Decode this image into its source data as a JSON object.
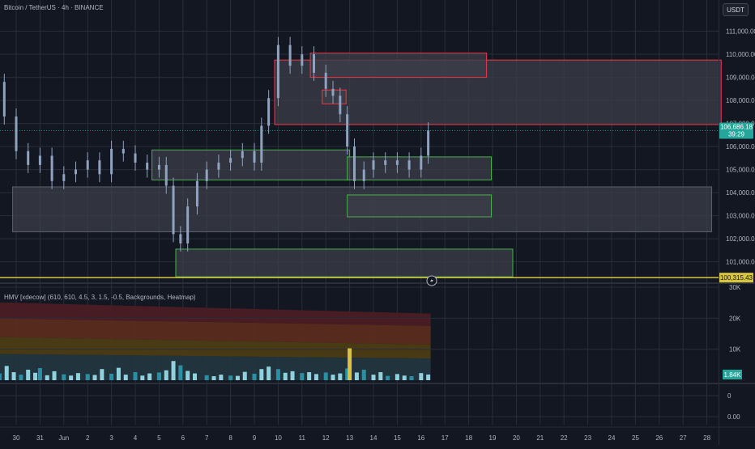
{
  "header": {
    "symbol_title": "Bitcoin / TetherUS · 4h · BINANCE",
    "currency_button": "USDT"
  },
  "indicator": {
    "label": "HMV [xdecow] (610, 610, 4.5, 3, 1.5, -0.5, Backgrounds, Heatmap)"
  },
  "colors": {
    "background": "#131722",
    "grid": "#2a2e39",
    "candle": "#8fa3c1",
    "red_zone_border": "#f23645",
    "green_zone_border": "#4caf50",
    "zone_fill": "#3c3f4a",
    "support_line": "#d7c440",
    "price_label_bg": "#26a69a",
    "volume_bar": "#8fd1dc",
    "volume_bar_dark": "#2b8fa3",
    "volume_spike": "#d7c440",
    "heat_red": "#4a1c24",
    "heat_orange": "#5a2c1e",
    "heat_olive": "#4a3c14",
    "heat_teal": "#223640"
  },
  "chart_data": [
    {
      "type": "candlestick",
      "title": "Bitcoin / TetherUS · 4h · BINANCE",
      "x_ticks": [
        "30",
        "31",
        "Jun",
        "2",
        "3",
        "4",
        "5",
        "6",
        "7",
        "8",
        "9",
        "10",
        "11",
        "12",
        "13",
        "14",
        "15",
        "16",
        "17",
        "18",
        "19",
        "20",
        "21",
        "22",
        "23",
        "24",
        "25",
        "26",
        "27",
        "28"
      ],
      "x_range": [
        29.0,
        28.2
      ],
      "y_ticks": [
        "111,000.00",
        "110,000.00",
        "109,000.00",
        "108,000.00",
        "107,000.00",
        "106,000.00",
        "105,000.00",
        "104,000.00",
        "103,000.00",
        "102,000.00",
        "101,000.00"
      ],
      "ylim": [
        100250,
        111300
      ],
      "grid": true,
      "last_price": {
        "value": 106686.18,
        "label": "106,686.18",
        "countdown": "39:29"
      },
      "support_line": {
        "value": 100315.43,
        "label": "100,315.43"
      },
      "zones": [
        {
          "kind": "bearish",
          "x0": 28.6,
          "x1": 9.85,
          "y_top": 109750,
          "y_bottom": 106950
        },
        {
          "kind": "bearish",
          "x0": 11.35,
          "x1": 18.75,
          "y_top": 110050,
          "y_bottom": 109000
        },
        {
          "kind": "bearish",
          "x0": 11.85,
          "x1": 12.85,
          "y_top": 108450,
          "y_bottom": 107850
        },
        {
          "kind": "neutral",
          "x0": 28.2,
          "x1": 29.85,
          "y_top": 104250,
          "y_bottom": 102300
        },
        {
          "kind": "bullish",
          "x0": 4.7,
          "x1": 13.0,
          "y_top": 105850,
          "y_bottom": 104550
        },
        {
          "kind": "bullish",
          "x0": 12.9,
          "x1": 18.95,
          "y_top": 105550,
          "y_bottom": 104550
        },
        {
          "kind": "bullish",
          "x0": 12.9,
          "x1": 18.95,
          "y_top": 103900,
          "y_bottom": 102950
        },
        {
          "kind": "bullish",
          "x0": 5.7,
          "x1": 19.85,
          "y_top": 101550,
          "y_bottom": 100350
        }
      ],
      "candles": [
        {
          "x": 29.0,
          "close": 108800
        },
        {
          "x": 29.5,
          "close": 107300
        },
        {
          "x": 30.0,
          "close": 105800
        },
        {
          "x": 30.5,
          "close": 105200
        },
        {
          "x": 31.0,
          "close": 105600
        },
        {
          "x": 31.5,
          "close": 104500
        },
        {
          "x": 1.0,
          "close": 104800
        },
        {
          "x": 1.5,
          "close": 105000
        },
        {
          "x": 2.0,
          "close": 105400
        },
        {
          "x": 2.5,
          "close": 104800
        },
        {
          "x": 3.0,
          "close": 105900
        },
        {
          "x": 3.5,
          "close": 105700
        },
        {
          "x": 4.0,
          "close": 105300
        },
        {
          "x": 4.5,
          "close": 105000
        },
        {
          "x": 5.0,
          "close": 105200
        },
        {
          "x": 5.3,
          "close": 104300
        },
        {
          "x": 5.6,
          "close": 102200
        },
        {
          "x": 5.9,
          "close": 101800
        },
        {
          "x": 6.2,
          "close": 103400
        },
        {
          "x": 6.6,
          "close": 104500
        },
        {
          "x": 7.0,
          "close": 105000
        },
        {
          "x": 7.5,
          "close": 105300
        },
        {
          "x": 8.0,
          "close": 105500
        },
        {
          "x": 8.5,
          "close": 105800
        },
        {
          "x": 9.0,
          "close": 105300
        },
        {
          "x": 9.3,
          "close": 106900
        },
        {
          "x": 9.6,
          "close": 108100
        },
        {
          "x": 10.0,
          "close": 110400
        },
        {
          "x": 10.5,
          "close": 109500
        },
        {
          "x": 11.0,
          "close": 110000
        },
        {
          "x": 11.5,
          "close": 109200
        },
        {
          "x": 12.0,
          "close": 108500
        },
        {
          "x": 12.3,
          "close": 108200
        },
        {
          "x": 12.6,
          "close": 107400
        },
        {
          "x": 12.9,
          "close": 106000
        },
        {
          "x": 13.2,
          "close": 104500
        },
        {
          "x": 13.6,
          "close": 105000
        },
        {
          "x": 14.0,
          "close": 105400
        },
        {
          "x": 14.5,
          "close": 105200
        },
        {
          "x": 15.0,
          "close": 105400
        },
        {
          "x": 15.5,
          "close": 105000
        },
        {
          "x": 16.0,
          "close": 105600
        },
        {
          "x": 16.3,
          "close": 106700
        }
      ]
    },
    {
      "type": "bar",
      "title": "HMV [xdecow] (610, 610, 4.5, 3, 1.5, -0.5, Backgrounds, Heatmap)",
      "y_ticks": [
        "30K",
        "20K",
        "10K"
      ],
      "ylim": [
        0,
        30000
      ],
      "last_value": {
        "value": 1840,
        "label": "1.84K"
      },
      "heatmap_bands": [
        {
          "name": "extra high",
          "y_bottom_start": 20000,
          "y_bottom_end": 17500,
          "y_top_start": 25200,
          "y_top_end": 21500
        },
        {
          "name": "high",
          "y_bottom_start": 14000,
          "y_bottom_end": 11500,
          "y_top_start": 20000,
          "y_top_end": 17500
        },
        {
          "name": "medium",
          "y_bottom_start": 8500,
          "y_bottom_end": 7000,
          "y_top_start": 14000,
          "y_top_end": 11500
        },
        {
          "name": "normal",
          "y_bottom_start": 0,
          "y_bottom_end": 0,
          "y_top_start": 8500,
          "y_top_end": 7000
        }
      ],
      "volumes": [
        {
          "x": 29.0,
          "value": 3800
        },
        {
          "x": 29.3,
          "value": 2200
        },
        {
          "x": 29.6,
          "value": 4600
        },
        {
          "x": 29.9,
          "value": 2600
        },
        {
          "x": 30.2,
          "value": 1800
        },
        {
          "x": 30.5,
          "value": 3400
        },
        {
          "x": 30.8,
          "value": 2400
        },
        {
          "x": 31.0,
          "value": 3900
        },
        {
          "x": 31.3,
          "value": 1600
        },
        {
          "x": 31.6,
          "value": 2900
        },
        {
          "x": 1.0,
          "value": 1900
        },
        {
          "x": 1.3,
          "value": 1500
        },
        {
          "x": 1.6,
          "value": 2300
        },
        {
          "x": 2.0,
          "value": 2000
        },
        {
          "x": 2.3,
          "value": 1700
        },
        {
          "x": 2.6,
          "value": 3600
        },
        {
          "x": 3.0,
          "value": 2100
        },
        {
          "x": 3.3,
          "value": 4000
        },
        {
          "x": 3.6,
          "value": 1800
        },
        {
          "x": 4.0,
          "value": 2600
        },
        {
          "x": 4.3,
          "value": 1500
        },
        {
          "x": 4.6,
          "value": 2200
        },
        {
          "x": 5.0,
          "value": 2500
        },
        {
          "x": 5.3,
          "value": 3200
        },
        {
          "x": 5.6,
          "value": 6200
        },
        {
          "x": 5.9,
          "value": 4800
        },
        {
          "x": 6.2,
          "value": 3000
        },
        {
          "x": 6.5,
          "value": 2200
        },
        {
          "x": 7.0,
          "value": 1600
        },
        {
          "x": 7.3,
          "value": 1300
        },
        {
          "x": 7.6,
          "value": 1800
        },
        {
          "x": 8.0,
          "value": 1500
        },
        {
          "x": 8.3,
          "value": 1400
        },
        {
          "x": 8.6,
          "value": 2700
        },
        {
          "x": 9.0,
          "value": 2100
        },
        {
          "x": 9.3,
          "value": 3600
        },
        {
          "x": 9.6,
          "value": 4400
        },
        {
          "x": 10.0,
          "value": 3600
        },
        {
          "x": 10.3,
          "value": 2400
        },
        {
          "x": 10.6,
          "value": 2900
        },
        {
          "x": 11.0,
          "value": 2300
        },
        {
          "x": 11.3,
          "value": 2600
        },
        {
          "x": 11.6,
          "value": 2000
        },
        {
          "x": 12.0,
          "value": 2500
        },
        {
          "x": 12.3,
          "value": 1800
        },
        {
          "x": 12.6,
          "value": 2200
        },
        {
          "x": 12.9,
          "value": 3800
        },
        {
          "x": 13.0,
          "value": 10300
        },
        {
          "x": 13.3,
          "value": 2500
        },
        {
          "x": 13.6,
          "value": 3400
        },
        {
          "x": 14.0,
          "value": 1800
        },
        {
          "x": 14.3,
          "value": 2600
        },
        {
          "x": 14.6,
          "value": 1400
        },
        {
          "x": 15.0,
          "value": 2000
        },
        {
          "x": 15.3,
          "value": 1500
        },
        {
          "x": 15.6,
          "value": 1300
        },
        {
          "x": 16.0,
          "value": 2300
        },
        {
          "x": 16.3,
          "value": 1840
        }
      ]
    },
    {
      "type": "line",
      "y_ticks": [
        "0",
        "0.00"
      ],
      "values": []
    }
  ]
}
